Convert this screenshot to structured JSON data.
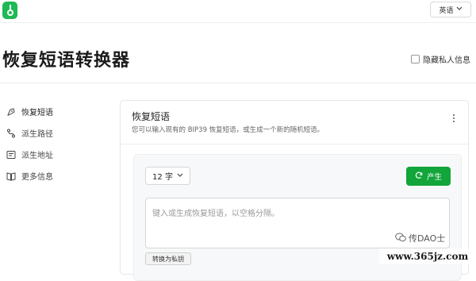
{
  "header": {
    "logo_icon": "app-logo-icon",
    "language_label": "英语",
    "brand_color": "#1db954"
  },
  "page": {
    "title": "恢复短语转换器",
    "hide_private_label": "隐藏私人信息"
  },
  "sidebar": {
    "items": [
      {
        "label": "恢复短语",
        "icon": "pen-nib-icon"
      },
      {
        "label": "派生路径",
        "icon": "route-icon"
      },
      {
        "label": "派生地址",
        "icon": "address-list-icon"
      },
      {
        "label": "更多信息",
        "icon": "book-icon"
      }
    ]
  },
  "card": {
    "title": "恢复短语",
    "description": "您可以输入现有的 BIP39 恢复短语，或生成一个新的随机短语。",
    "word_count": "12 字",
    "generate_label": "产生",
    "generate_color": "#12a53a",
    "input_placeholder": "键入或生成恢复短语，以空格分隔。",
    "convert_label": "转换为私钥"
  },
  "watermark": {
    "author": "传DAO士",
    "url": "www.365jz.com"
  }
}
